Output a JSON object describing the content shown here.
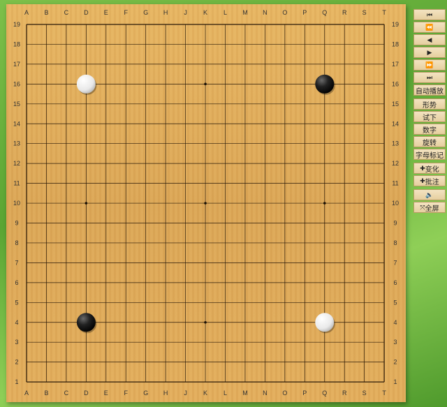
{
  "board": {
    "columns": [
      "A",
      "B",
      "C",
      "D",
      "E",
      "F",
      "G",
      "H",
      "J",
      "K",
      "L",
      "M",
      "N",
      "O",
      "P",
      "Q",
      "R",
      "S",
      "T"
    ],
    "rows": [
      "19",
      "18",
      "17",
      "16",
      "15",
      "14",
      "13",
      "12",
      "11",
      "10",
      "9",
      "8",
      "7",
      "6",
      "5",
      "4",
      "3",
      "2",
      "1"
    ],
    "star_points": [
      "D16",
      "K16",
      "Q16",
      "D10",
      "K10",
      "Q10",
      "D4",
      "K4",
      "Q4"
    ],
    "stones": [
      {
        "point": "D16",
        "color": "white"
      },
      {
        "point": "Q16",
        "color": "black"
      },
      {
        "point": "D4",
        "color": "black"
      },
      {
        "point": "Q4",
        "color": "white"
      }
    ]
  },
  "controls": {
    "first_icon": "first-move-icon",
    "fast_back_icon": "fast-backward-icon",
    "back_icon": "step-back-icon",
    "forward_icon": "step-forward-icon",
    "fast_forward_icon": "fast-forward-icon",
    "last_icon": "last-move-icon",
    "autoplay": "自动播放",
    "situation": "形势",
    "try": "试下",
    "numbers": "数字",
    "rotate": "旋转",
    "letter_marks": "字母标记",
    "variation": "变化",
    "comment": "批注",
    "sound_icon": "sound-icon",
    "fullscreen": "全屏"
  }
}
